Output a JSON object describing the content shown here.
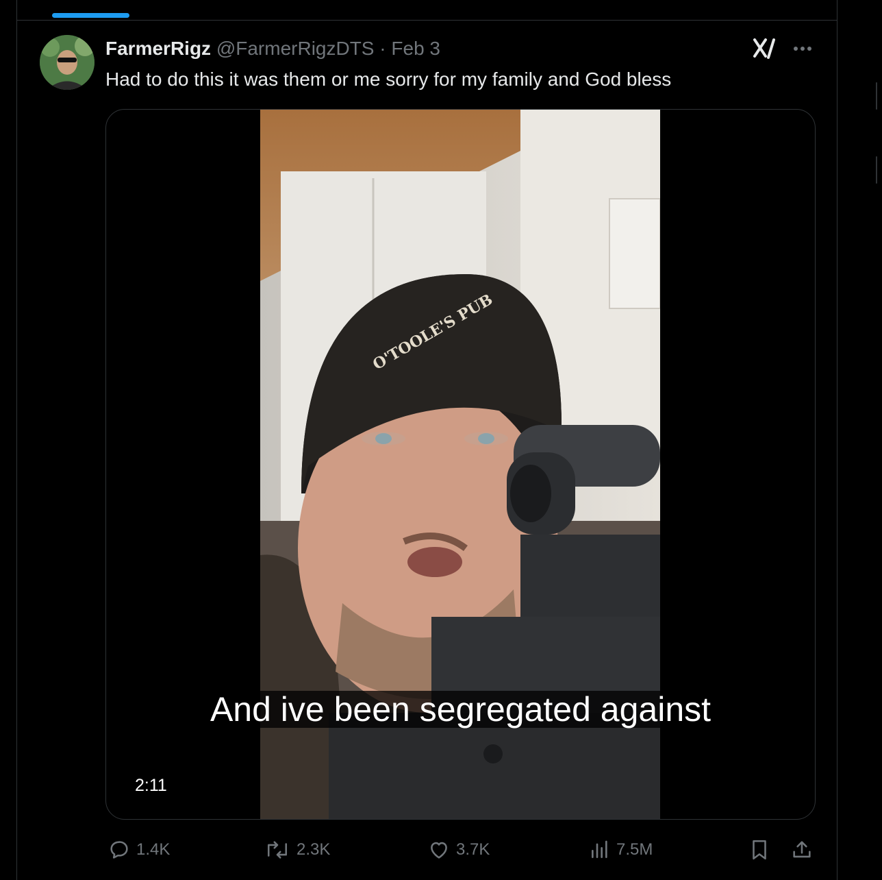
{
  "tweet": {
    "display_name": "FarmerRigz",
    "handle": "@FarmerRigzDTS",
    "separator": "·",
    "date": "Feb 3",
    "text": "Had to do this it was them or me sorry for my family and God bless"
  },
  "media": {
    "caption": "And ive been segregated against",
    "duration": "2:11",
    "hat_text": "O'TOOLE'S PUB"
  },
  "actions": {
    "replies": "1.4K",
    "reposts": "2.3K",
    "likes": "3.7K",
    "views": "7.5M"
  },
  "icons": {
    "reply": "reply-icon",
    "repost": "repost-icon",
    "like": "heart-icon",
    "views": "views-icon",
    "bookmark": "bookmark-icon",
    "share": "share-icon",
    "grok": "grok-icon",
    "more": "more-icon"
  },
  "colors": {
    "accent": "#1d9bf0",
    "background": "#000000",
    "text_primary": "#e7e9ea",
    "text_secondary": "#71767b",
    "border": "#2f3336"
  }
}
